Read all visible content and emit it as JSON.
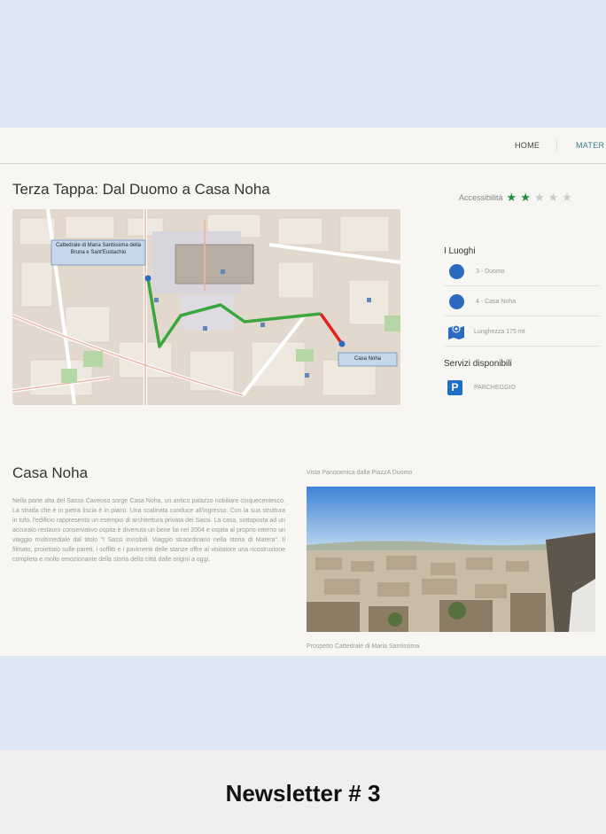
{
  "nav": {
    "home": "HOME",
    "mater": "MATER"
  },
  "page_title": "Terza Tappa: Dal Duomo a Casa Noha",
  "map": {
    "label_cathedral": "Cattedrale di Maria Santissima della Bruna e Sant'Eustachio",
    "label_casa_noha": "Casa Noha"
  },
  "accessibility": {
    "label": "Accessibilità",
    "rating": 2,
    "max": 5
  },
  "luoghi": {
    "heading": "I Luoghi",
    "items": [
      "3 - Duomo",
      "4 - Casa Noha"
    ],
    "length": "Lunghezza 175 mt"
  },
  "servizi": {
    "heading": "Servizi disponibili",
    "parking_icon": "P",
    "parking_label": "PARCHEGGIO"
  },
  "section": {
    "title": "Casa Noha",
    "body": "Nella parte alta del Sasso Caveoso sorge Casa Noha, un antico palazzo nobiliare cinquecentesco. La strada che è in pietra liscia è in piano. Una scalinata conduce all'ingresso. Con la sua struttura in tufo, l'edificio rappresenta un esempio di architettura privata dei Sassi. La casa, sottoposta ad un accurato restauro conservativo ospita è divenuta un bene fai nel 2004 e ospita al proprio interno un viaggio multimediale dal titolo \"I Sassi invisibili. Viaggio straordinario nella storia di Matera\". Il filmato, proiettato sulle pareti, i soffitti e i pavimenti delle stanze offre al visitatore una ricostruzione completa e molto emozionante della storia della città dalle origini a oggi."
  },
  "photo": {
    "caption_top": "Vista Panoramica dalla PiazzA Duomo",
    "caption_bottom": "Prospetto Cattedrale di Maria Santissima"
  },
  "footer": {
    "newsletter": "Newsletter # 3"
  }
}
